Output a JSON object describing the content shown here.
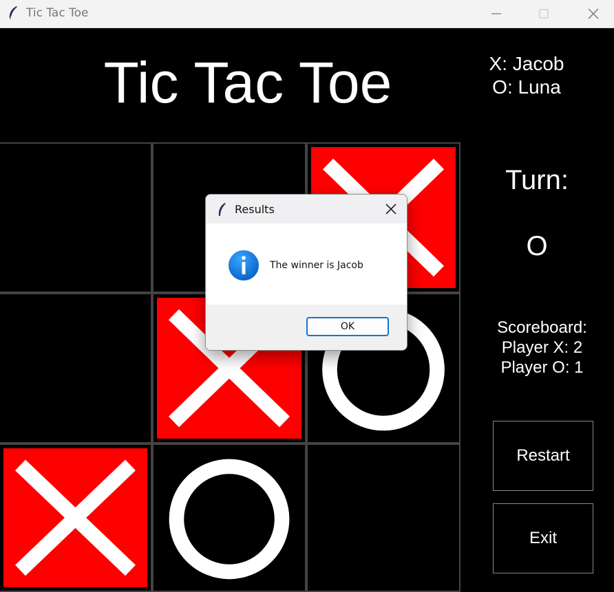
{
  "window": {
    "title": "Tic Tac Toe",
    "app_icon": "feather-icon",
    "controls": [
      "minimize-icon",
      "maximize-icon",
      "close-icon"
    ]
  },
  "game": {
    "title": "Tic Tac Toe",
    "players": {
      "x": "X: Jacob",
      "o": "O: Luna"
    },
    "turn_label": "Turn:",
    "turn_value": "O",
    "scoreboard": {
      "heading": "Scoreboard:",
      "x": "Player X: 2",
      "o": "Player O: 1"
    },
    "buttons": {
      "restart": "Restart",
      "exit": "Exit"
    },
    "colors": {
      "background": "#000000",
      "x_fill": "#ff0000",
      "mark": "#ffffff"
    },
    "board": [
      [
        "",
        "",
        "X"
      ],
      [
        "",
        "X",
        "O"
      ],
      [
        "X",
        "O",
        ""
      ]
    ]
  },
  "dialog": {
    "title": "Results",
    "title_icon": "feather-icon",
    "message_icon": "info-icon",
    "message": "The winner is Jacob",
    "ok_label": "OK"
  }
}
